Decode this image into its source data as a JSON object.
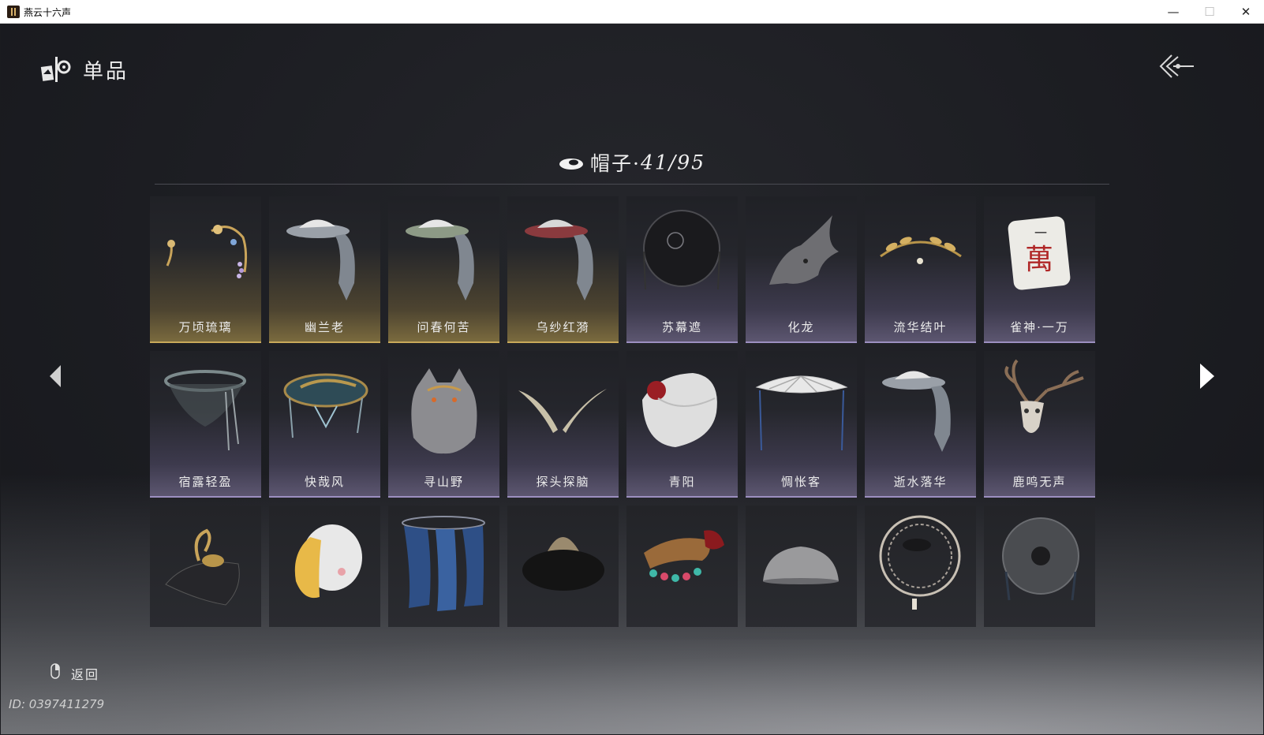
{
  "window": {
    "title": "燕云十六声",
    "minimize_symbol": "—",
    "maximize_symbol": "☐",
    "close_symbol": "✕"
  },
  "header": {
    "title": "单品",
    "icon": "item-emblem-icon",
    "back_icon": "double-chevron-back-icon"
  },
  "category": {
    "icon": "hat-icon",
    "label": "帽子·",
    "count": "41/95"
  },
  "items": [
    {
      "name": "万顷琉璃",
      "rarity": "gold",
      "icon": "hairpin-icon"
    },
    {
      "name": "幽兰老",
      "rarity": "gold",
      "icon": "veil-hat-icon"
    },
    {
      "name": "问春何苦",
      "rarity": "gold",
      "icon": "veil-hat-icon"
    },
    {
      "name": "乌纱红漪",
      "rarity": "gold",
      "icon": "veil-hat-icon"
    },
    {
      "name": "苏幕遮",
      "rarity": "purple",
      "icon": "black-hat-icon"
    },
    {
      "name": "化龙",
      "rarity": "purple",
      "icon": "dragon-head-icon"
    },
    {
      "name": "流华结叶",
      "rarity": "purple",
      "icon": "laurel-wreath-icon"
    },
    {
      "name": "雀神·一万",
      "rarity": "purple",
      "icon": "mahjong-tile-icon",
      "tile_top": "一",
      "tile_main": "萬"
    },
    {
      "name": "宿露轻盈",
      "rarity": "purple",
      "icon": "veil-hat-icon"
    },
    {
      "name": "快哉风",
      "rarity": "purple",
      "icon": "ornate-hat-icon"
    },
    {
      "name": "寻山野",
      "rarity": "purple",
      "icon": "wolf-head-icon"
    },
    {
      "name": "探头探脑",
      "rarity": "purple",
      "icon": "feather-antenna-icon"
    },
    {
      "name": "青阳",
      "rarity": "purple",
      "icon": "white-cap-icon"
    },
    {
      "name": "惆怅客",
      "rarity": "purple",
      "icon": "white-veil-hat-icon"
    },
    {
      "name": "逝水落华",
      "rarity": "purple",
      "icon": "veil-hat-icon"
    },
    {
      "name": "鹿鸣无声",
      "rarity": "purple",
      "icon": "deer-skull-icon"
    },
    {
      "name": "",
      "rarity": "plain",
      "icon": "swan-hat-icon"
    },
    {
      "name": "",
      "rarity": "plain",
      "icon": "chick-hood-icon"
    },
    {
      "name": "",
      "rarity": "plain",
      "icon": "blue-veil-icon"
    },
    {
      "name": "",
      "rarity": "plain",
      "icon": "fur-hat-icon"
    },
    {
      "name": "",
      "rarity": "plain",
      "icon": "beaded-headdress-icon"
    },
    {
      "name": "",
      "rarity": "plain",
      "icon": "bowl-hat-icon"
    },
    {
      "name": "",
      "rarity": "plain",
      "icon": "bamboo-hat-icon"
    },
    {
      "name": "",
      "rarity": "plain",
      "icon": "woven-hat-icon"
    }
  ],
  "nav": {
    "prev_icon": "arrow-left-icon",
    "next_icon": "arrow-right-icon"
  },
  "footer": {
    "mouse_icon": "mouse-icon",
    "return_label": "返回",
    "player_id": "ID: 0397411279"
  },
  "colors": {
    "gold_accent": "#c8a95a",
    "purple_accent": "#9c8fc0",
    "background": "#1c1d22"
  }
}
